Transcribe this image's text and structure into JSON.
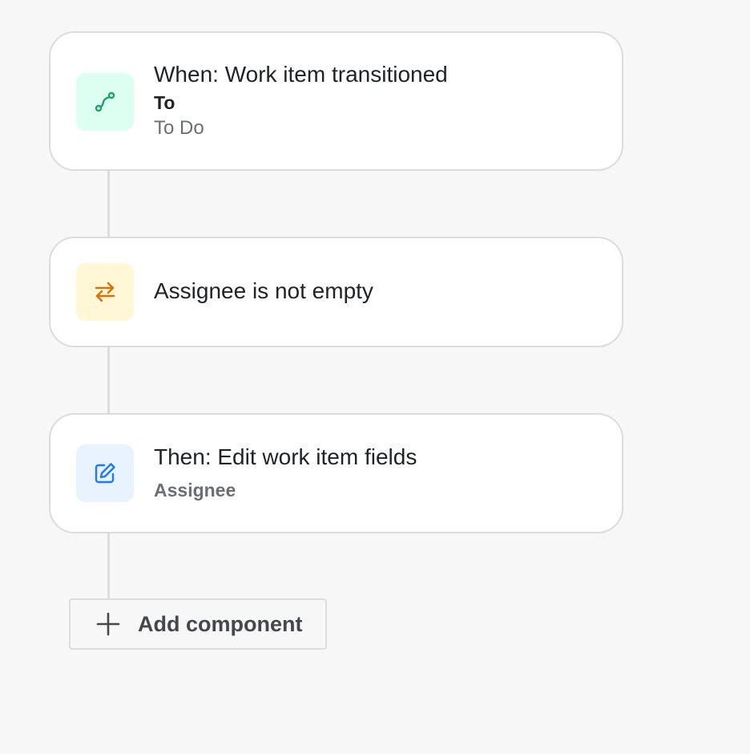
{
  "trigger": {
    "title": "When: Work item transitioned",
    "field_label": "To",
    "field_value": "To Do",
    "icon": "branch-path-icon",
    "icon_bg": "#dcfff1",
    "icon_color": "#22a06b"
  },
  "condition": {
    "title": "Assignee is not empty",
    "icon": "swap-arrows-icon",
    "icon_bg": "#fff7d6",
    "icon_color": "#d97008"
  },
  "action": {
    "title": "Then: Edit work item fields",
    "field": "Assignee",
    "icon": "edit-icon",
    "icon_bg": "#e9f2ff",
    "icon_color": "#1d7afc"
  },
  "add_component": {
    "label": "Add component",
    "icon": "plus-icon"
  }
}
